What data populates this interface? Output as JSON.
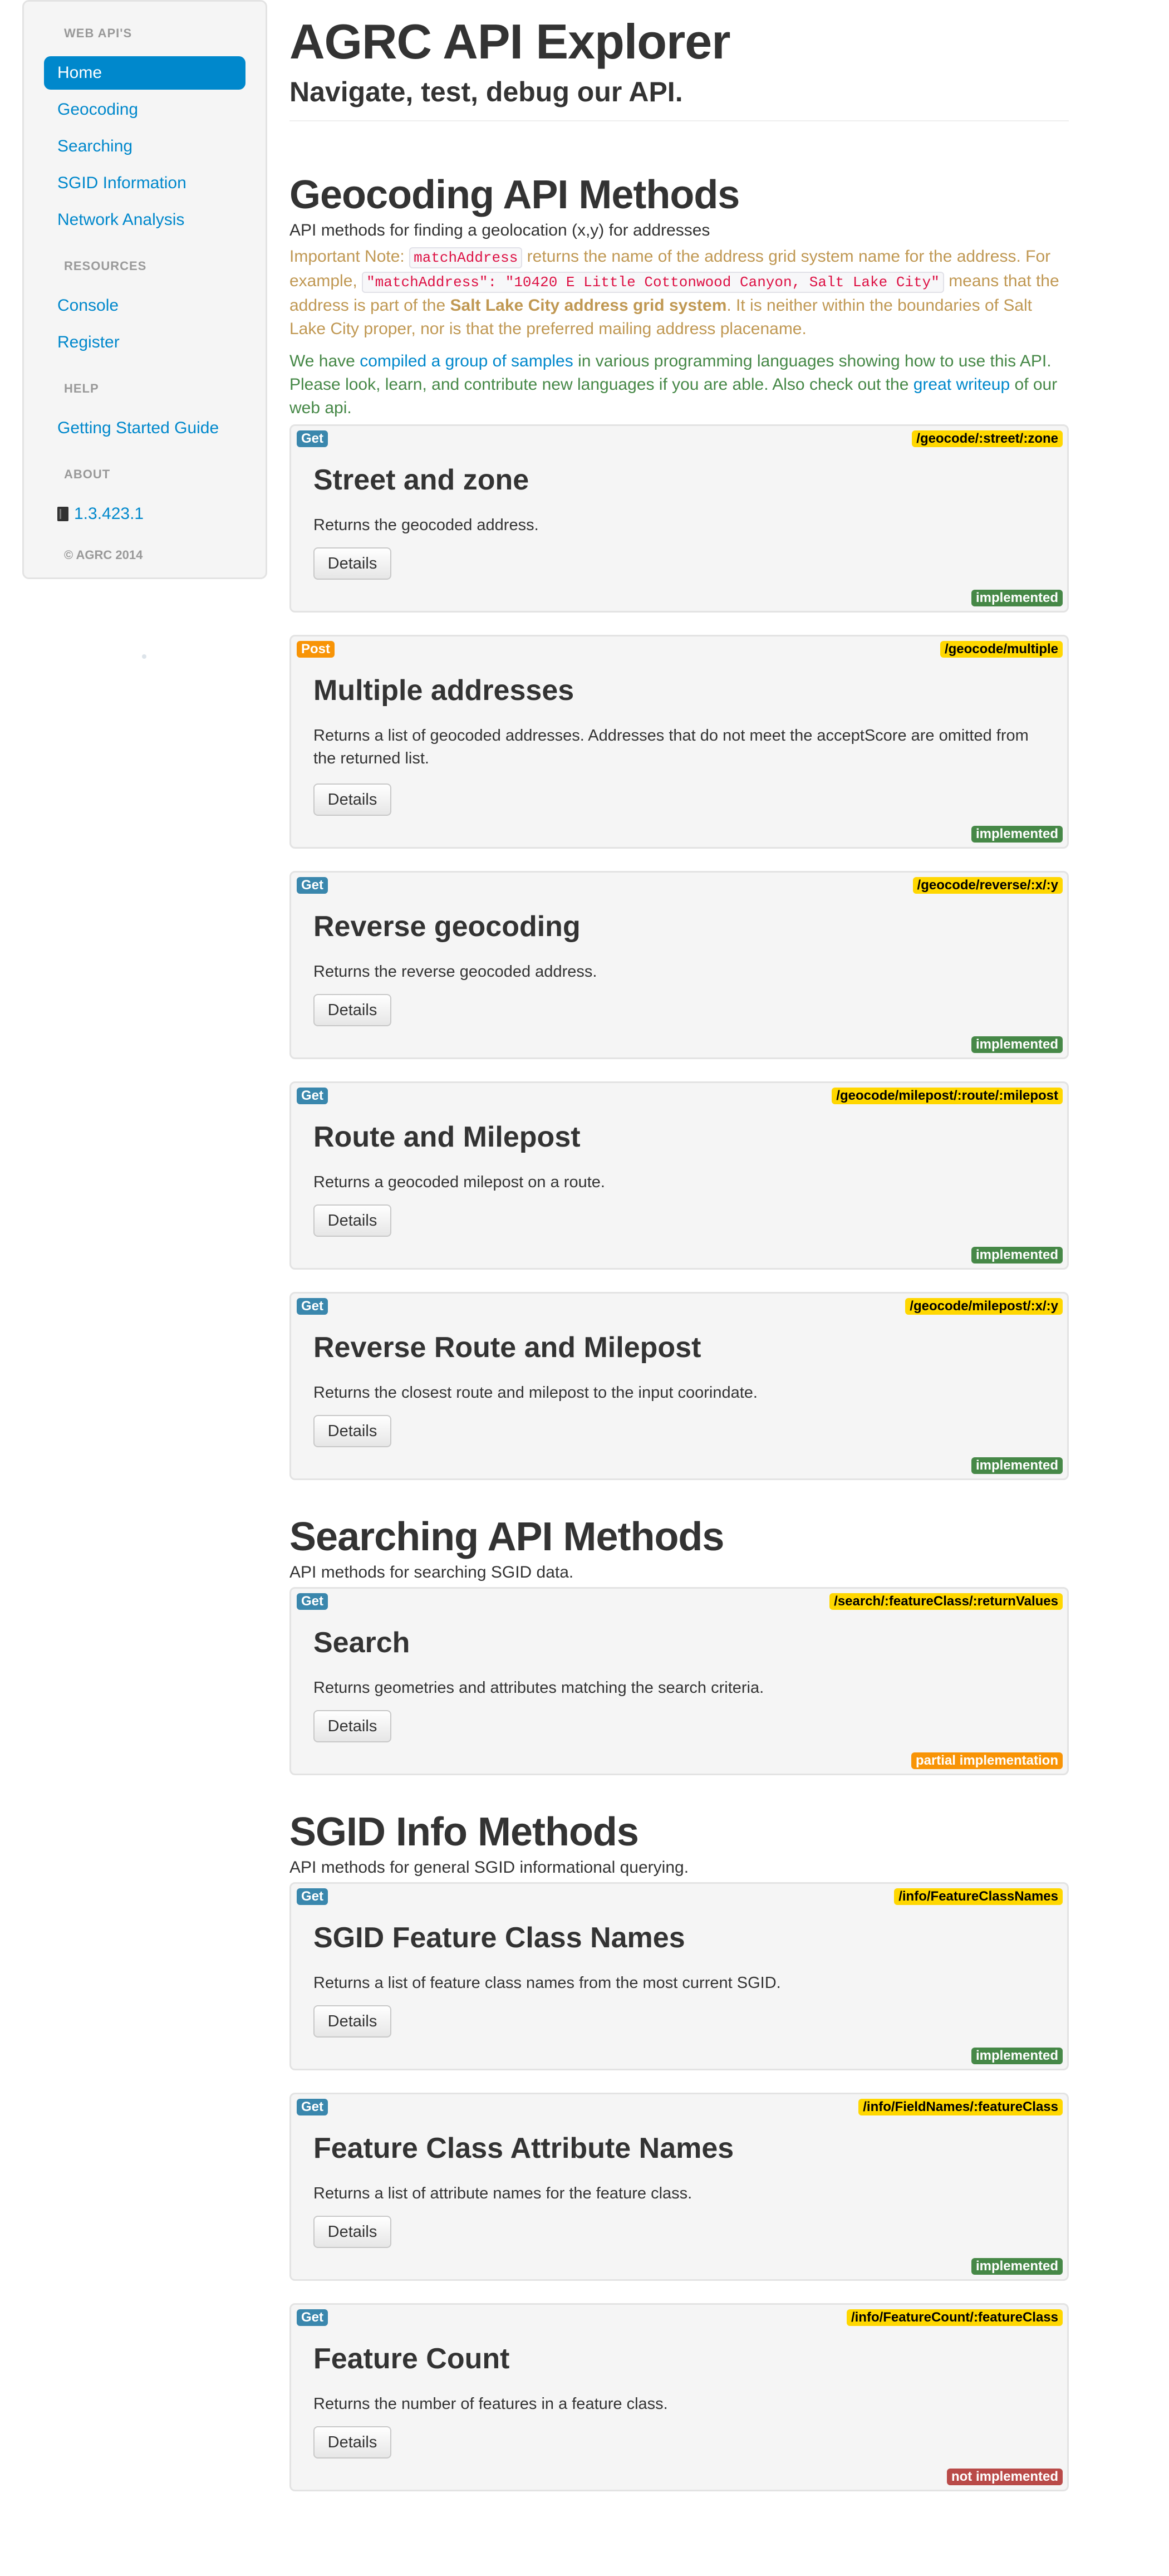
{
  "sidebar": {
    "web_apis_header": "WEB API'S",
    "web_apis": [
      "Home",
      "Geocoding",
      "Searching",
      "SGID Information",
      "Network Analysis"
    ],
    "resources_header": "RESOURCES",
    "resources": [
      "Console",
      "Register"
    ],
    "help_header": "HELP",
    "help": [
      "Getting Started Guide"
    ],
    "about_header": "ABOUT",
    "version": "1.3.423.1",
    "copyright": "© AGRC 2014"
  },
  "header": {
    "title": "AGRC API Explorer",
    "subtitle": "Navigate, test, debug our API."
  },
  "geocoding": {
    "title": "Geocoding API Methods",
    "desc": "API methods for finding a geolocation (x,y) for addresses",
    "note_prefix": "Important Note: ",
    "note_code1": "matchAddress",
    "note_mid1": " returns the name of the address grid system name for the address. For example, ",
    "note_code2": "\"matchAddress\": \"10420 E Little Cottonwood Canyon, Salt Lake City\"",
    "note_mid2": " means that the address is part of the ",
    "note_bold": "Salt Lake City address grid system",
    "note_end": ". It is neither within the boundaries of Salt Lake City proper, nor is that the preferred mailing address placename.",
    "samples_prefix": "We have ",
    "samples_link": "compiled a group of samples",
    "samples_mid": " in various programming languages showing how to use this API. Please look, learn, and contribute new languages if you are able. Also check out the ",
    "writeup_link": "great writeup",
    "samples_end": " of our web api.",
    "methods": [
      {
        "verb": "Get",
        "route": "/geocode/:street/:zone",
        "title": "Street and zone",
        "desc": "Returns the geocoded address.",
        "button": "Details",
        "status": "implemented"
      },
      {
        "verb": "Post",
        "route": "/geocode/multiple",
        "title": "Multiple addresses",
        "desc": "Returns a list of geocoded addresses. Addresses that do not meet the acceptScore are omitted from the returned list.",
        "button": "Details",
        "status": "implemented"
      },
      {
        "verb": "Get",
        "route": "/geocode/reverse/:x/:y",
        "title": "Reverse geocoding",
        "desc": "Returns the reverse geocoded address.",
        "button": "Details",
        "status": "implemented"
      },
      {
        "verb": "Get",
        "route": "/geocode/milepost/:route/:milepost",
        "title": "Route and Milepost",
        "desc": "Returns a geocoded milepost on a route.",
        "button": "Details",
        "status": "implemented"
      },
      {
        "verb": "Get",
        "route": "/geocode/milepost/:x/:y",
        "title": "Reverse Route and Milepost",
        "desc": "Returns the closest route and milepost to the input coorindate.",
        "button": "Details",
        "status": "implemented"
      }
    ]
  },
  "searching": {
    "title": "Searching API Methods",
    "desc": "API methods for searching SGID data.",
    "methods": [
      {
        "verb": "Get",
        "route": "/search/:featureClass/:returnValues",
        "title": "Search",
        "desc": "Returns geometries and attributes matching the search criteria.",
        "button": "Details",
        "status": "partial implementation"
      }
    ]
  },
  "sgid": {
    "title": "SGID Info Methods",
    "desc": "API methods for general SGID informational querying.",
    "methods": [
      {
        "verb": "Get",
        "route": "/info/FeatureClassNames",
        "title": "SGID Feature Class Names",
        "desc": "Returns a list of feature class names from the most current SGID.",
        "button": "Details",
        "status": "implemented"
      },
      {
        "verb": "Get",
        "route": "/info/FieldNames/:featureClass",
        "title": "Feature Class Attribute Names",
        "desc": "Returns a list of attribute names for the feature class.",
        "button": "Details",
        "status": "implemented"
      },
      {
        "verb": "Get",
        "route": "/info/FeatureCount/:featureClass",
        "title": "Feature Count",
        "desc": "Returns the number of features in a feature class.",
        "button": "Details",
        "status": "not implemented"
      }
    ]
  },
  "colors": {
    "link": "#0088cc",
    "get": "#3a87ad",
    "post": "#f89406",
    "route": "#ffd700",
    "implemented": "#468847",
    "partial": "#f89406",
    "not_implemented": "#b94a48",
    "warning_text": "#c09853",
    "success_text": "#468847"
  }
}
